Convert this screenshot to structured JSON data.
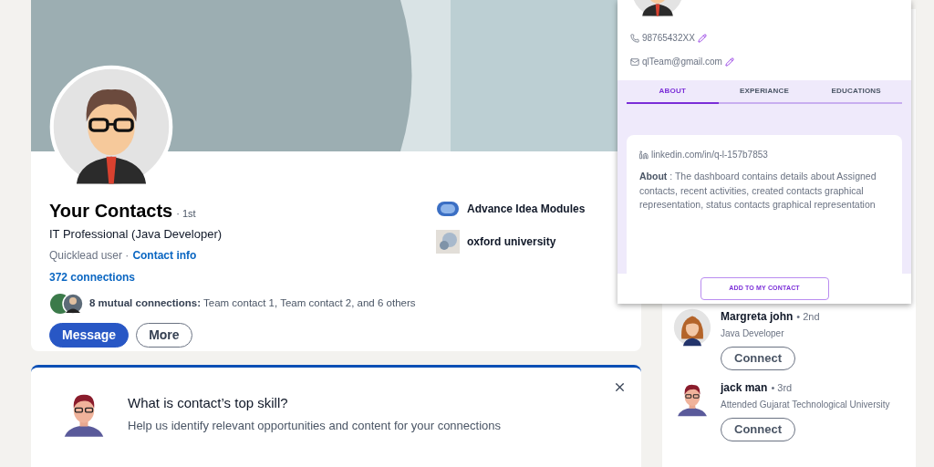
{
  "profile": {
    "name": "Your Contacts",
    "degree": "· 1st",
    "headline": "IT Professional (Java Developer)",
    "source": "Quicklead user ·",
    "contact_link": "Contact info",
    "connections": "372 connections",
    "mutual": "**8 mutual connections:** Team contact 1, Team contact 2, and 6 others",
    "buttons": [
      {
        "label": "Message",
        "kind": "primary"
      },
      {
        "label": "More",
        "kind": "secondary"
      }
    ],
    "organizations": [
      {
        "name": "Advance Idea Modules",
        "kind": "company"
      },
      {
        "name": "oxford university",
        "kind": "school"
      }
    ]
  },
  "skill_prompt": {
    "title": "What is contact’s top skill?",
    "subtitle": "Help us identify relevant opportunities and content for your connections"
  },
  "suggestions": [
    {
      "name": "Margreta john",
      "degree": "• 2nd",
      "headline": "Java Developer",
      "button": "Connect",
      "kind": "woman"
    },
    {
      "name": "jack man",
      "degree": "• 3rd",
      "headline": "Attended Gujarat Technological University",
      "button": "Connect",
      "kind": "man"
    }
  ],
  "contact_popup": {
    "phone": "98765432XX",
    "email": "qlTeam@gmail.com",
    "tabs": [
      {
        "label": "ABOUT",
        "selected": true
      },
      {
        "label": "EXPERIANCE",
        "selected": false
      },
      {
        "label": "EDUCATIONS",
        "selected": false
      }
    ],
    "linkedin": "linkedin.com/in/q-l-157b7853",
    "about": "**About** : The dashboard contains details about Assigned contacts, recent activities, created contacts graphical representation, status contacts graphical representation",
    "button": "ADD TO MY CONTACT"
  }
}
